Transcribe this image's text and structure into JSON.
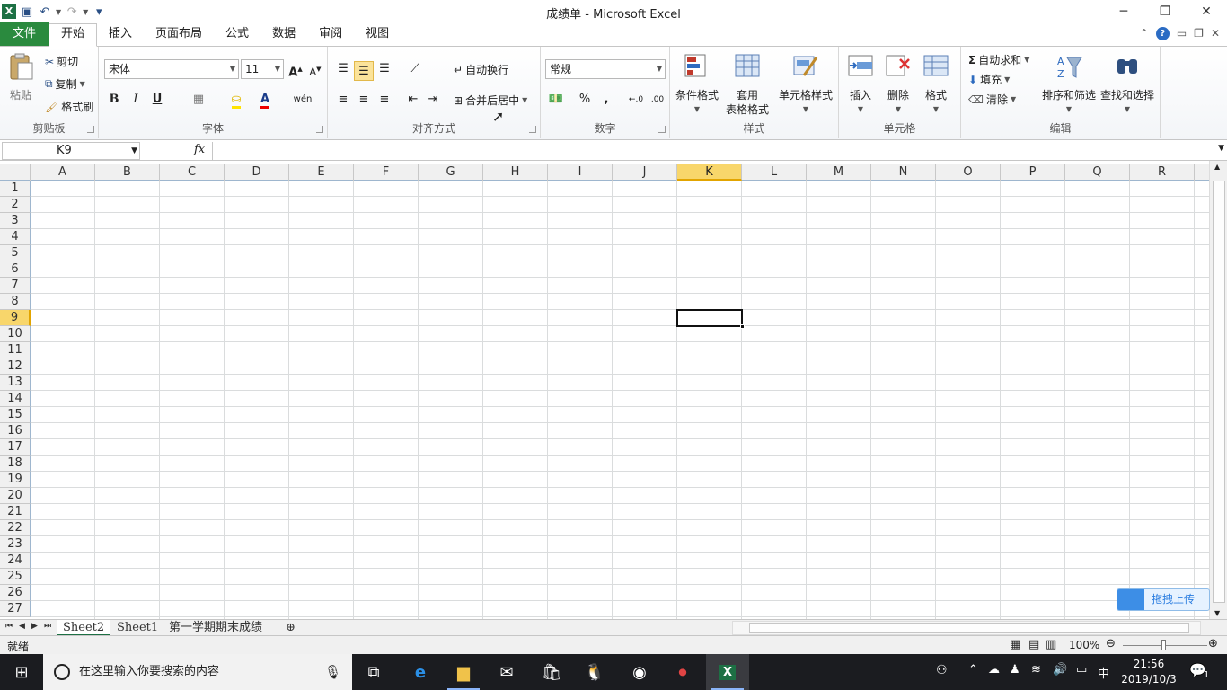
{
  "window": {
    "title": "成绩单  -  Microsoft Excel",
    "minimize": "─",
    "restore": "❐",
    "close": "✕"
  },
  "qat": {
    "logo": "X",
    "undo_icon": "undo-icon",
    "redo_icon": "redo-icon"
  },
  "tabs": {
    "file": "文件",
    "items": [
      "开始",
      "插入",
      "页面布局",
      "公式",
      "数据",
      "审阅",
      "视图"
    ],
    "active": "开始"
  },
  "ribbon": {
    "clipboard": {
      "label": "剪贴板",
      "paste": "粘贴",
      "cut": "剪切",
      "copy": "复制",
      "format_painter": "格式刷"
    },
    "font": {
      "label": "字体",
      "family": "宋体",
      "size": "11",
      "bold": "B",
      "italic": "I",
      "underline": "U",
      "grow": "A",
      "shrink": "A",
      "phonetic": "wén"
    },
    "alignment": {
      "label": "对齐方式",
      "wrap": "自动换行",
      "merge": "合并后居中"
    },
    "number": {
      "label": "数字",
      "format": "常规",
      "percent": "%",
      "comma": ",",
      "inc_decimal": "←.0",
      "dec_decimal": ".00"
    },
    "styles": {
      "label": "样式",
      "conditional": "条件格式",
      "table_line1": "套用",
      "table_line2": "表格格式",
      "cell_styles": "单元格样式"
    },
    "cells": {
      "label": "单元格",
      "insert": "插入",
      "delete": "删除",
      "format": "格式"
    },
    "editing": {
      "label": "编辑",
      "autosum": "自动求和",
      "fill": "填充",
      "clear": "清除",
      "sort_filter": "排序和筛选",
      "find_select": "查找和选择"
    }
  },
  "formula_bar": {
    "name_box": "K9",
    "fx": "fx",
    "value": ""
  },
  "grid": {
    "columns": [
      "A",
      "B",
      "C",
      "D",
      "E",
      "F",
      "G",
      "H",
      "I",
      "J",
      "K",
      "L",
      "M",
      "N",
      "O",
      "P",
      "Q",
      "R"
    ],
    "rows": [
      "1",
      "2",
      "3",
      "4",
      "5",
      "6",
      "7",
      "8",
      "9",
      "10",
      "11",
      "12",
      "13",
      "14",
      "15",
      "16",
      "17",
      "18",
      "19",
      "20",
      "21",
      "22",
      "23",
      "24",
      "25",
      "26",
      "27"
    ],
    "selected_col": "K",
    "selected_row": "9"
  },
  "sheet_tabs": [
    "Sheet2",
    "Sheet1",
    "第一学期期末成绩"
  ],
  "active_sheet": "Sheet2",
  "status": {
    "mode": "就绪",
    "zoom": "100%"
  },
  "baidu": {
    "label": "拖拽上传"
  },
  "taskbar": {
    "search_placeholder": "在这里输入你要搜索的内容",
    "time": "21:56",
    "date": "2019/10/3",
    "ime": "中",
    "notification_count": "1"
  }
}
